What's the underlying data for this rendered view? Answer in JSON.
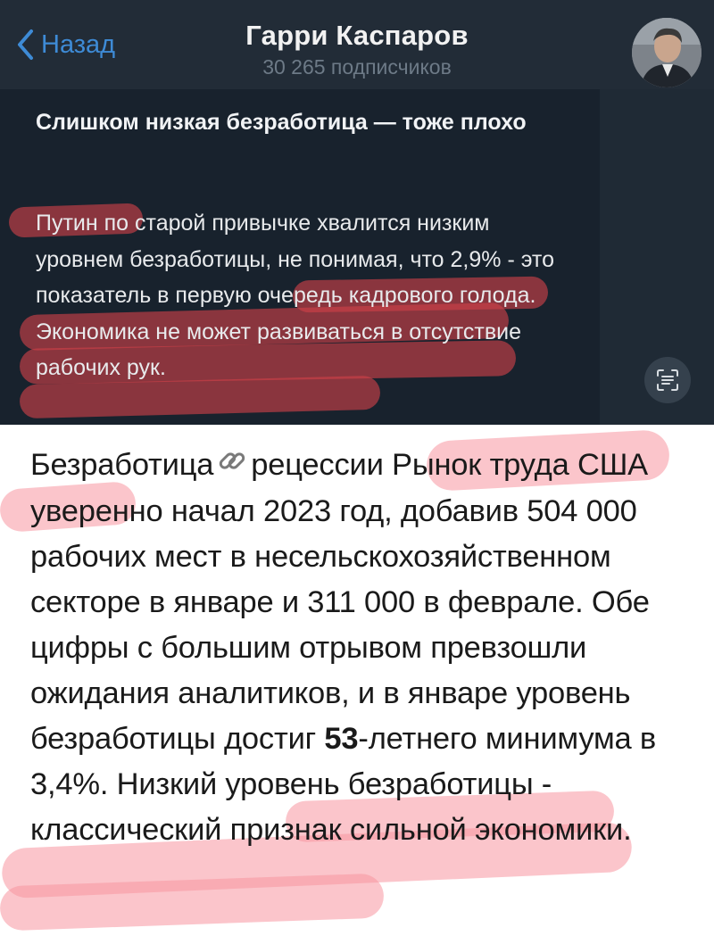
{
  "header": {
    "back_label": "Назад",
    "channel_name": "Гарри Каспаров",
    "subscribers": "30 265 подписчиков"
  },
  "post": {
    "title": "Слишком низкая безработица — тоже плохо",
    "body": "Путин по старой привычке хвалится низким уровнем безработицы, не понимая, что 2,9% - это показатель в первую очередь кадрового голода. Экономика не может развиваться в отсутствие рабочих рук."
  },
  "article": {
    "part1": "Безработица",
    "link_icon": "chain-link-icon",
    "part2": "рецессии Рынок труда США уверенно начал 2023 год, добавив 504 000 рабочих мест в несельскохозяйственном секторе в январе и 311 000 в феврале. Обе цифры с большим отрывом превзошли ожидания аналитиков, и в январе уровень безработицы достиг ",
    "bold": "53",
    "part3": "-летнего минимума в 3,4%. Низкий уровень безработицы - классический признак сильной экономики."
  },
  "colors": {
    "dark_bg": "#1c2733",
    "accent": "#3e8bd6",
    "highlight_dark": "#d04048",
    "highlight_light": "#f796a0"
  }
}
